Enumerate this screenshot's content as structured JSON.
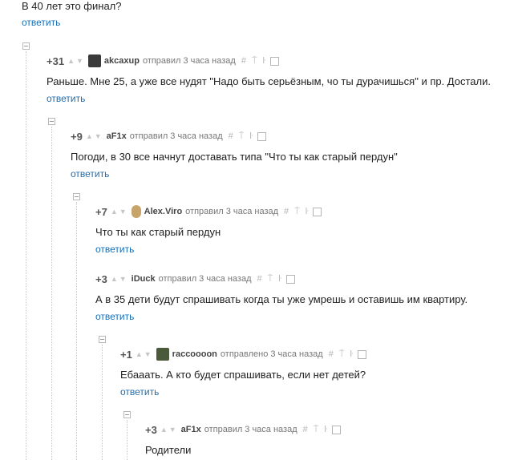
{
  "top": {
    "text": "В 40 лет это финал?",
    "reply": "ответить"
  },
  "comments": [
    {
      "rating": "+31",
      "author": "akcaxup",
      "sent": "отправил",
      "time": "3 часа назад",
      "text": "Раньше. Мне 25, а уже все нудят \"Надо быть серьёзным, чо ты дурачишься\" и пр. Достали.",
      "reply": "ответить"
    },
    {
      "rating": "+9",
      "author": "aF1x",
      "sent": "отправил",
      "time": "3 часа назад",
      "text": "Погоди, в 30 все начнут доставать типа \"Что ты как старый пердун\"",
      "reply": "ответить"
    },
    {
      "rating": "+7",
      "author": "Alex.Viro",
      "sent": "отправил",
      "time": "3 часа назад",
      "text": "Что ты как старый пердун",
      "reply": "ответить"
    },
    {
      "rating": "+3",
      "author": "iDuck",
      "sent": "отправил",
      "time": "3 часа назад",
      "text": "А в 35 дети будут спрашивать когда ты уже умрешь и оставишь им квартиру.",
      "reply": "ответить"
    },
    {
      "rating": "+1",
      "author": "raccoooon",
      "sent": "отправлено",
      "time": "3 часа назад",
      "text": "Ебааать. А кто будет спрашивать, если нет детей?",
      "reply": "ответить"
    },
    {
      "rating": "+3",
      "author": "aF1x",
      "sent": "отправил",
      "time": "3 часа назад",
      "text": "Родители",
      "reply": ""
    }
  ],
  "icons": {
    "vote_up": "▲",
    "vote_down": "▼",
    "hash": "#",
    "pin": "⍑",
    "branch": "ŀ"
  }
}
